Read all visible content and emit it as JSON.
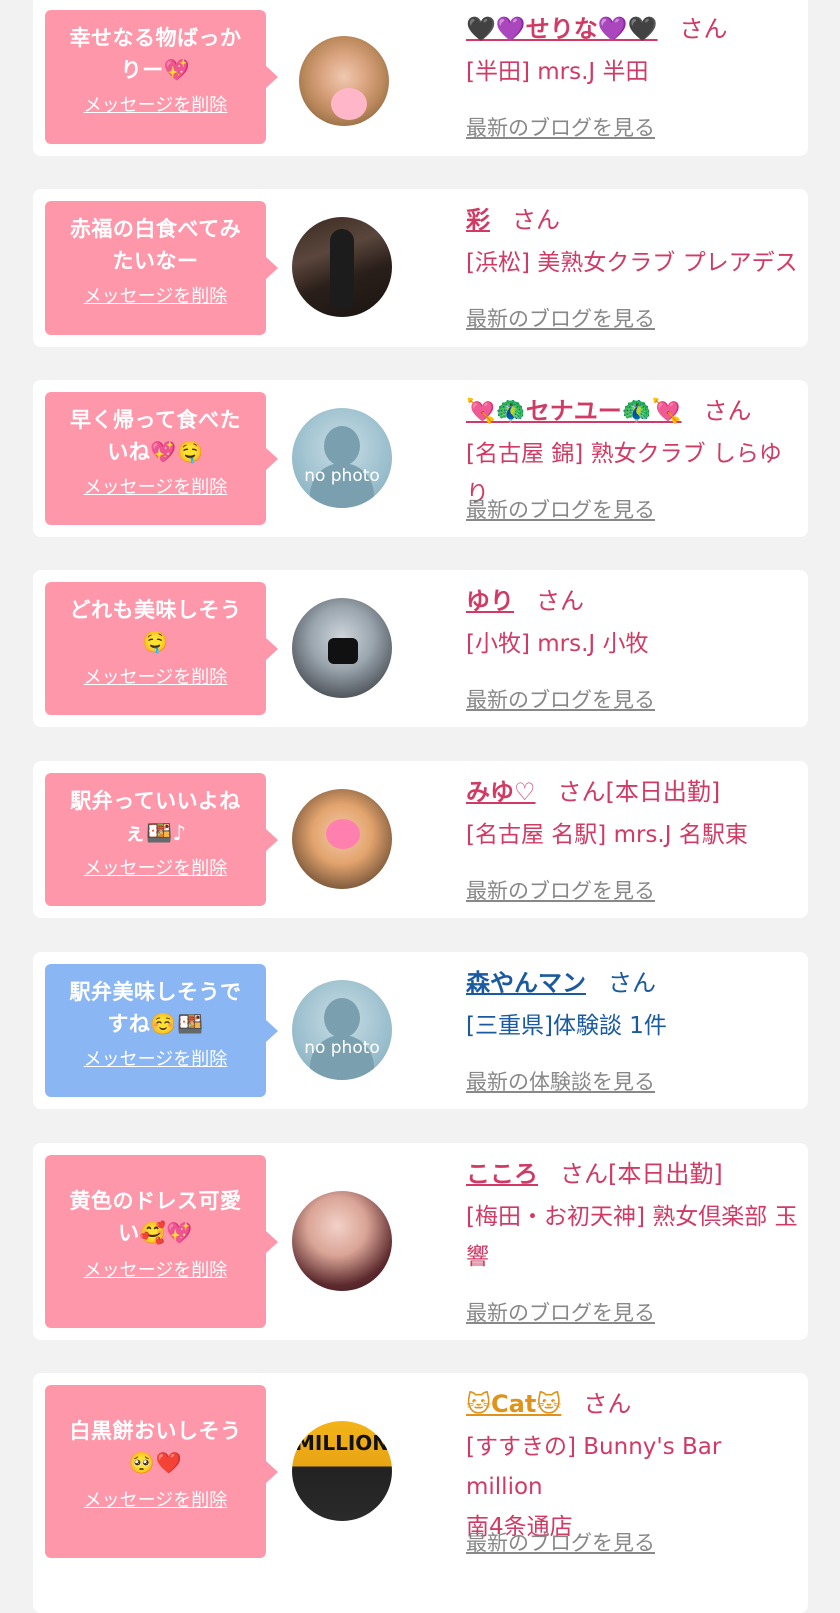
{
  "colors": {
    "bubble_pink": "#ff97ab",
    "bubble_blue": "#8bb6f4",
    "name_pink": "#d13a64",
    "name_blue": "#1a5aa0",
    "name_orange": "#e0931a",
    "link_gray": "#888888",
    "page_bg": "#f2f2f2"
  },
  "delete_label": "メッセージを削除",
  "san_label": "さん",
  "items": [
    {
      "message_line1": "幸せなる物ばっか",
      "message_line2": "りー💖",
      "avatar_icon": "profile-photo",
      "name": "🖤💜せりな💜🖤",
      "name_color": "pink",
      "suffix": "",
      "shop": "[半田] mrs.J 半田",
      "latest_link": "最新のブログを見る"
    },
    {
      "message_line1": "赤福の白食べてみ",
      "message_line2": "たいなー",
      "avatar_icon": "profile-photo",
      "name": "彩",
      "name_color": "pink",
      "suffix": "",
      "shop": "[浜松] 美熟女クラブ プレアデス",
      "latest_link": "最新のブログを見る"
    },
    {
      "message_line1": "早く帰って食べた",
      "message_line2": "いね💖🤤",
      "avatar_icon": "no-photo",
      "name": "💘🦚セナユー🦚💘",
      "name_color": "pink",
      "suffix": "",
      "shop": "[名古屋 錦] 熟女クラブ しらゆり",
      "latest_link": "最新のブログを見る"
    },
    {
      "message_line1": "どれも美味しそう",
      "message_line2": "🤤",
      "avatar_icon": "profile-photo",
      "name": "ゆり",
      "name_color": "pink",
      "suffix": "",
      "shop": "[小牧] mrs.J 小牧",
      "latest_link": "最新のブログを見る"
    },
    {
      "message_line1": "駅弁っていいよね",
      "message_line2": "ぇ🍱♪",
      "avatar_icon": "profile-photo",
      "name": "みゆ♡",
      "name_color": "pink",
      "suffix": "[本日出勤]",
      "shop": "[名古屋 名駅] mrs.J 名駅東",
      "latest_link": "最新のブログを見る"
    },
    {
      "message_line1": "駅弁美味しそうで",
      "message_line2": "すね☺️🍱",
      "avatar_icon": "no-photo",
      "name": "森やんマン",
      "name_color": "blue",
      "suffix": "",
      "shop": "[三重県]体験談 1件",
      "latest_link": "最新の体験談を見る"
    },
    {
      "message_line1": "黄色のドレス可愛",
      "message_line2": "い🥰💖",
      "avatar_icon": "profile-photo",
      "name": "こころ",
      "name_color": "pink",
      "suffix": "[本日出勤]",
      "shop": "[梅田・お初天神] 熟女倶楽部 玉",
      "shop2": "響",
      "latest_link": "最新のブログを見る"
    },
    {
      "message_line1": "白黒餅おいしそう",
      "message_line2": "🥺❤️",
      "avatar_icon": "profile-photo",
      "name": "🐱Cat🐱",
      "name_color": "orange",
      "suffix": "",
      "shop": "[すすきの] Bunny's Bar million",
      "shop2": "南4条通店",
      "latest_link": "最新のブログを見る"
    }
  ]
}
